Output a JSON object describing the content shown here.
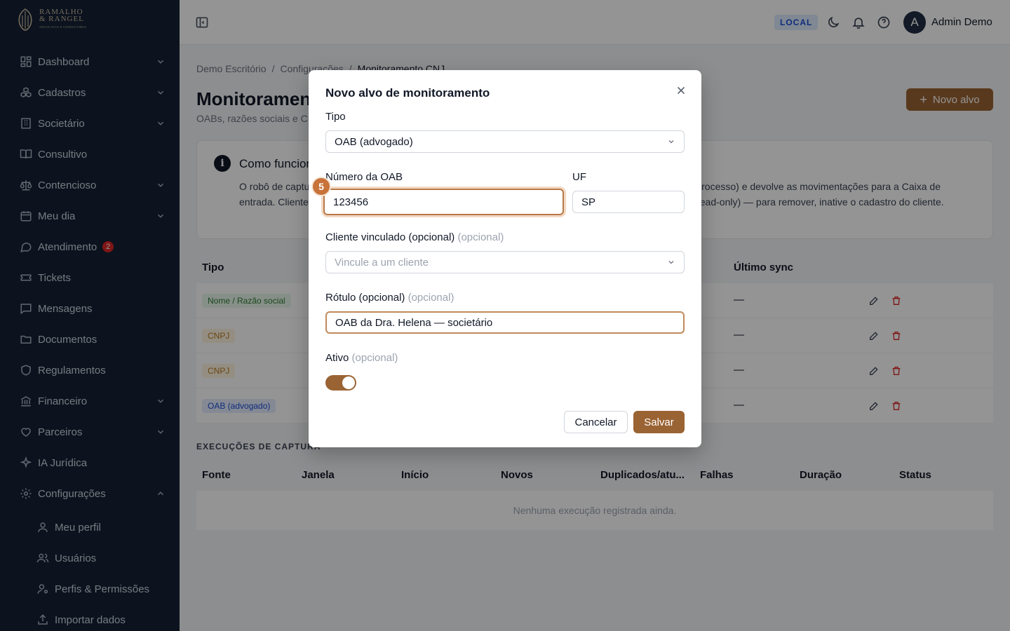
{
  "brand": {
    "line1": "RAMALHO",
    "line2": "& RANGEL",
    "tagline": "ADVOCACIA E CONSULTORIA"
  },
  "sidebar": {
    "items": [
      {
        "label": "Dashboard",
        "icon": "grid-icon",
        "expandable": true
      },
      {
        "label": "Cadastros",
        "icon": "boxes-icon",
        "expandable": true
      },
      {
        "label": "Societário",
        "icon": "building-icon",
        "expandable": true
      },
      {
        "label": "Consultivo",
        "icon": "book-open-icon",
        "expandable": false
      },
      {
        "label": "Contencioso",
        "icon": "scale-icon",
        "expandable": true
      },
      {
        "label": "Meu dia",
        "icon": "calendar-icon",
        "expandable": true
      },
      {
        "label": "Atendimento",
        "icon": "chat-bubble-icon",
        "expandable": false,
        "badge": "2"
      },
      {
        "label": "Tickets",
        "icon": "ticket-icon",
        "expandable": false
      },
      {
        "label": "Mensagens",
        "icon": "message-square-icon",
        "expandable": false
      },
      {
        "label": "Documentos",
        "icon": "folder-icon",
        "expandable": false
      },
      {
        "label": "Regulamentos",
        "icon": "shield-icon",
        "expandable": false
      },
      {
        "label": "Financeiro",
        "icon": "bank-icon",
        "expandable": true
      },
      {
        "label": "Parceiros",
        "icon": "handshake-icon",
        "expandable": true
      },
      {
        "label": "IA Jurídica",
        "icon": "sparkles-icon",
        "expandable": false
      },
      {
        "label": "Configurações",
        "icon": "gear-icon",
        "expandable": true,
        "expanded": true
      }
    ],
    "subitems": [
      {
        "label": "Meu perfil",
        "icon": "user-icon"
      },
      {
        "label": "Usuários",
        "icon": "users-icon"
      },
      {
        "label": "Perfis & Permissões",
        "icon": "user-cog-icon"
      },
      {
        "label": "Importar dados",
        "icon": "upload-icon"
      }
    ]
  },
  "topbar": {
    "env_badge": "LOCAL",
    "user_initial": "A",
    "user_name": "Admin Demo"
  },
  "main": {
    "breadcrumb": [
      "Demo Escritório",
      "Configurações",
      "Monitoramento CNJ"
    ],
    "breadcrumb_sep": "/",
    "title": "Monitoramento CNJ",
    "subtitle": "OABs, razões sociais e CNPJs monitorados",
    "new_button": "Novo alvo",
    "info": {
      "title": "Como funciona",
      "text": "O robô de captura consulta periodicamente os tribunais por cada alvo (OAB, nome ou CNPJ da parte do processo) e devolve as movimentações para a Caixa de entrada. Clientes com OAB ou CNPJ cadastrados são incluídos automaticamente como alvos herdados (read-only) — para remover, inative o cadastro do cliente."
    },
    "targets_table": {
      "headers": {
        "tipo": "Tipo",
        "last_sync": "Último sync"
      },
      "rows": [
        {
          "tipo": "Nome / Razão social",
          "tone": "green",
          "last_sync": "—"
        },
        {
          "tipo": "CNPJ",
          "tone": "amber",
          "last_sync": "—"
        },
        {
          "tipo": "CNPJ",
          "tone": "amber",
          "last_sync": "—"
        },
        {
          "tipo": "OAB (advogado)",
          "tone": "blue",
          "last_sync": "—"
        }
      ]
    },
    "runs_section_label": "EXECUÇÕES DE CAPTURA",
    "runs_table": {
      "headers": [
        "Fonte",
        "Janela",
        "Início",
        "Novos",
        "Duplicados/atu...",
        "Falhas",
        "Duração",
        "Status"
      ],
      "empty": "Nenhuma execução registrada ainda."
    }
  },
  "modal": {
    "title": "Novo alvo de monitoramento",
    "tipo_label": "Tipo",
    "tipo_value": "OAB (advogado)",
    "oab_label": "Número da OAB",
    "oab_value": "123456",
    "uf_label": "UF",
    "uf_value": "SP",
    "cliente_label": "Cliente vinculado (opcional)",
    "cliente_opt": "(opcional)",
    "cliente_placeholder": "Vincule a um cliente",
    "rotulo_label": "Rótulo (opcional)",
    "rotulo_opt": "(opcional)",
    "rotulo_value": "OAB da Dra. Helena — societário",
    "ativo_label": "Ativo",
    "ativo_opt": "(opcional)",
    "ativo_on": true,
    "cancel": "Cancelar",
    "save": "Salvar",
    "step_badge": "5"
  },
  "colors": {
    "sidebar": "#152236",
    "accent": "#9a6333",
    "focus_ring": "#c8733a"
  }
}
